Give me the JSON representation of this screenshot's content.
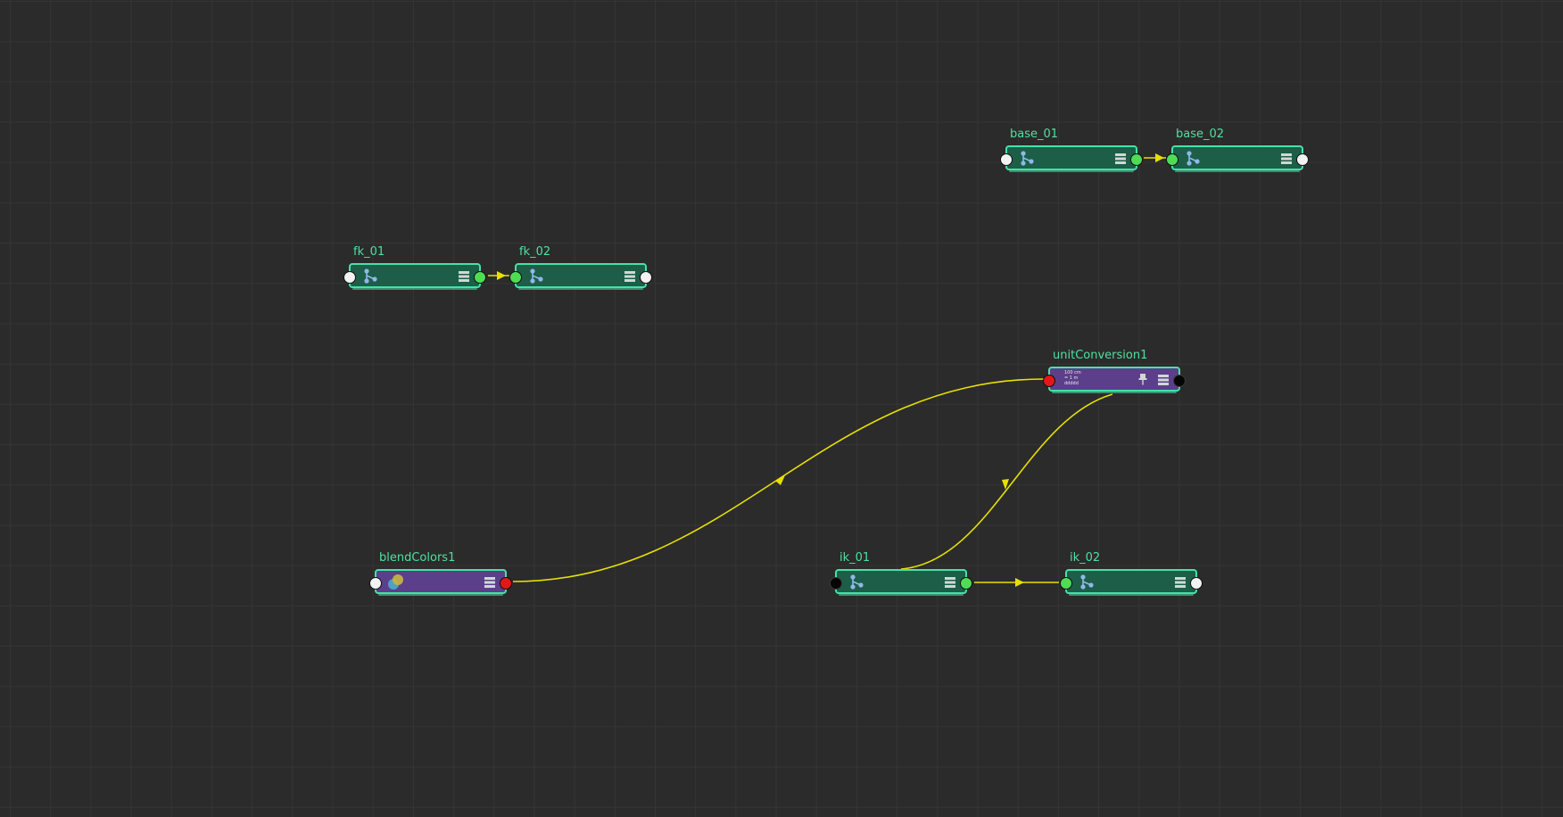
{
  "editor": {
    "background": "#2b2b2b",
    "grid_color": "#353535",
    "wire_color": "#e8e000"
  },
  "colors": {
    "transform_node": "#1c5e48",
    "utility_node": "#5b3f8a",
    "node_border": "#45e2a8",
    "label": "#4fe0a0",
    "port_white": "#f2f2f2",
    "port_green": "#4fdc55",
    "port_red": "#e01818",
    "port_black": "#050505"
  },
  "nodes": {
    "base_01": {
      "label": "base_01",
      "icon": "joint-icon",
      "menu_icon": "menu-icon"
    },
    "base_02": {
      "label": "base_02",
      "icon": "joint-icon",
      "menu_icon": "menu-icon"
    },
    "fk_01": {
      "label": "fk_01",
      "icon": "joint-icon",
      "menu_icon": "menu-icon"
    },
    "fk_02": {
      "label": "fk_02",
      "icon": "joint-icon",
      "menu_icon": "menu-icon"
    },
    "unitConversion1": {
      "label": "unitConversion1",
      "icon": "unit-conversion-icon",
      "menu_icon": "menu-icon",
      "pin_icon": "pin-icon",
      "icon_text": "100 cm\n= 1 m\nddddd"
    },
    "blendColors1": {
      "label": "blendColors1",
      "icon": "blend-colors-icon",
      "menu_icon": "menu-icon"
    },
    "ik_01": {
      "label": "ik_01",
      "icon": "joint-icon",
      "menu_icon": "menu-icon"
    },
    "ik_02": {
      "label": "ik_02",
      "icon": "joint-icon",
      "menu_icon": "menu-icon"
    }
  },
  "connections": [
    {
      "from": "base_01",
      "to": "base_02"
    },
    {
      "from": "fk_01",
      "to": "fk_02"
    },
    {
      "from": "blendColors1",
      "to": "unitConversion1"
    },
    {
      "from": "unitConversion1",
      "to": "ik_01"
    },
    {
      "from": "ik_01",
      "to": "ik_02"
    }
  ]
}
